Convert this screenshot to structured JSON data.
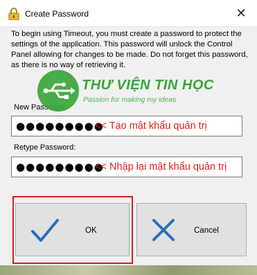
{
  "window": {
    "title": "Create Password",
    "close_glyph": "✕"
  },
  "description": "To begin using Timeout, you must create a password to protect the settings of the application. This password will unlock the Control Panel allowing for changes to be made. Do not forget this password, as there is no way of retrieving it.",
  "fields": {
    "new_password": {
      "label": "New Password:",
      "value_masked": "●●●●●●●●●",
      "annotation": "<< Tạo mật khẩu quản trị"
    },
    "retype_password": {
      "label": "Retype Password:",
      "value_masked": "●●●●●●●●●",
      "annotation": "<< Nhập lại mật khẩu quản trị"
    }
  },
  "buttons": {
    "ok": {
      "label": "OK",
      "icon": "checkmark-icon"
    },
    "cancel": {
      "label": "Cancel",
      "icon": "x-icon"
    }
  },
  "watermark": {
    "title": "THƯ VIỆN TIN HỌC",
    "slogan": "Passion for making my ideas",
    "icon": "usb-icon"
  },
  "colors": {
    "annotation": "#e0201a",
    "highlight_outline": "#d21f1f",
    "icon_blue": "#2a6db5",
    "watermark_green": "#37a537"
  }
}
